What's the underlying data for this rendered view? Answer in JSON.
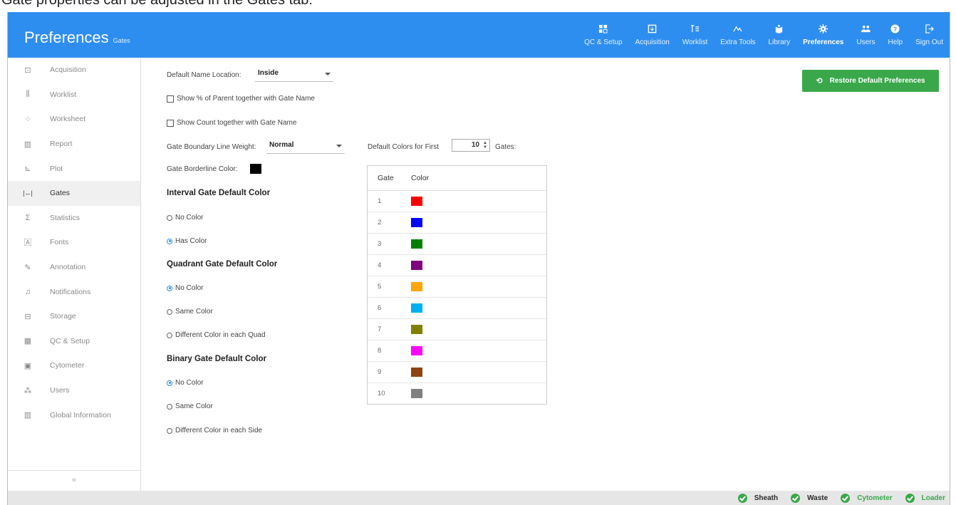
{
  "caption": "Gate properties can be adjusted in the Gates tab:",
  "header": {
    "title": "Preferences",
    "subtitle": "Gates",
    "nav": [
      {
        "label": "QC & Setup",
        "icon": "qc-setup-icon"
      },
      {
        "label": "Acquisition",
        "icon": "acquisition-icon"
      },
      {
        "label": "Worklist",
        "icon": "worklist-icon"
      },
      {
        "label": "Extra Tools",
        "icon": "extra-tools-icon"
      },
      {
        "label": "Library",
        "icon": "library-icon"
      },
      {
        "label": "Preferences",
        "icon": "gear-icon"
      },
      {
        "label": "Users",
        "icon": "users-icon"
      },
      {
        "label": "Help",
        "icon": "help-icon"
      },
      {
        "label": "Sign Out",
        "icon": "sign-out-icon"
      }
    ]
  },
  "sidebar": {
    "items": [
      {
        "label": "Acquisition",
        "icon": "acquisition-icon"
      },
      {
        "label": "Worklist",
        "icon": "worklist-icon"
      },
      {
        "label": "Worksheet",
        "icon": "worksheet-icon"
      },
      {
        "label": "Report",
        "icon": "report-icon"
      },
      {
        "label": "Plot",
        "icon": "plot-icon"
      },
      {
        "label": "Gates",
        "icon": "gates-icon"
      },
      {
        "label": "Statistics",
        "icon": "statistics-icon"
      },
      {
        "label": "Fonts",
        "icon": "fonts-icon"
      },
      {
        "label": "Annotation",
        "icon": "annotation-icon"
      },
      {
        "label": "Notifications",
        "icon": "bell-icon"
      },
      {
        "label": "Storage",
        "icon": "storage-icon"
      },
      {
        "label": "QC & Setup",
        "icon": "qc-setup-icon"
      },
      {
        "label": "Cytometer",
        "icon": "cytometer-icon"
      },
      {
        "label": "Users",
        "icon": "users-icon"
      },
      {
        "label": "Global Information",
        "icon": "global-info-icon"
      }
    ],
    "active": "Gates",
    "collapse_label": "«"
  },
  "settings": {
    "default_name_location_label": "Default Name Location:",
    "default_name_location_value": "Inside",
    "show_percent_label": "Show % of Parent together with Gate Name",
    "show_count_label": "Show Count together with Gate Name",
    "line_weight_label": "Gate Boundary Line Weight:",
    "line_weight_value": "Normal",
    "border_color_label": "Gate Borderline Color:",
    "border_color": "#000000",
    "default_colors_label": "Default Colors for First",
    "default_colors_count": "10",
    "default_colors_suffix": "Gates:",
    "interval": {
      "heading": "Interval Gate Default Color",
      "options": [
        "No Color",
        "Has Color"
      ],
      "selected": 1
    },
    "quadrant": {
      "heading": "Quadrant Gate Default Color",
      "options": [
        "No Color",
        "Same Color",
        "Different Color in each Quad"
      ],
      "selected": 0
    },
    "binary": {
      "heading": "Binary Gate Default Color",
      "options": [
        "No Color",
        "Same Color",
        "Different Color in each Side"
      ],
      "selected": 0
    }
  },
  "gate_table": {
    "headers": [
      "Gate",
      "Color"
    ],
    "rows": [
      {
        "gate": "1",
        "color": "#ff0000"
      },
      {
        "gate": "2",
        "color": "#0000ff"
      },
      {
        "gate": "3",
        "color": "#008000"
      },
      {
        "gate": "4",
        "color": "#800080"
      },
      {
        "gate": "5",
        "color": "#ffa500"
      },
      {
        "gate": "6",
        "color": "#00b0f0"
      },
      {
        "gate": "7",
        "color": "#808000"
      },
      {
        "gate": "8",
        "color": "#ff00ff"
      },
      {
        "gate": "9",
        "color": "#8b4513"
      },
      {
        "gate": "10",
        "color": "#808080"
      }
    ]
  },
  "restore_button": "Restore Default Preferences",
  "status": [
    {
      "label": "Sheath",
      "color": "#2a2a2a"
    },
    {
      "label": "Waste",
      "color": "#2a2a2a"
    },
    {
      "label": "Cytometer",
      "color": "#3aa84a"
    },
    {
      "label": "Loader",
      "color": "#3aa84a"
    }
  ]
}
